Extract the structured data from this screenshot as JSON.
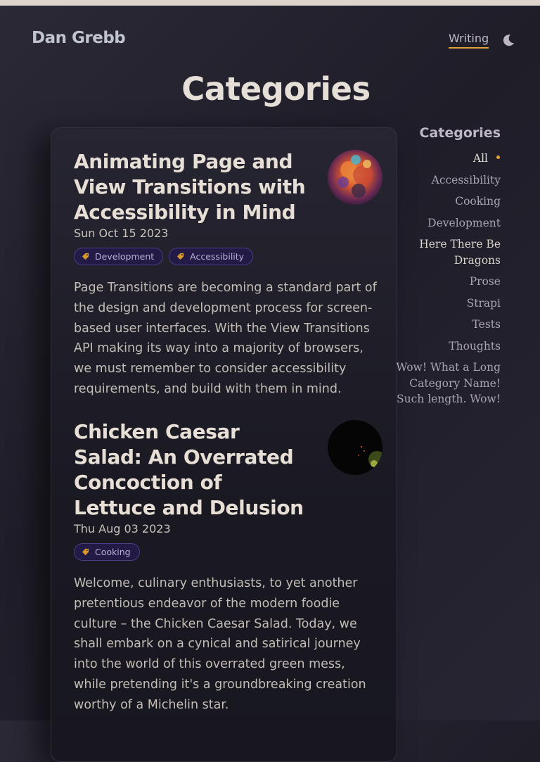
{
  "site": {
    "title": "Dan Grebb"
  },
  "nav": {
    "items": [
      {
        "label": "Writing",
        "active": true
      }
    ],
    "theme_toggle_icon": "moon-icon"
  },
  "page": {
    "heading": "Categories"
  },
  "posts": [
    {
      "title": "Animating Page and View Transitions with Accessibility in Mind",
      "date": "Sun Oct 15 2023",
      "tags": [
        "Development",
        "Accessibility"
      ],
      "excerpt": "Page Transitions are becoming a standard part of the design and development process for screen-based user interfaces. With the View Transitions API making its way into a majority of browsers, we must remember to consider accessibility requirements, and build with them in mind.",
      "thumbnail": "colorful-cloud-image"
    },
    {
      "title": "Chicken Caesar Salad: An Overrated Concoction of Lettuce and Delusion",
      "date": "Thu Aug 03 2023",
      "tags": [
        "Cooking"
      ],
      "excerpt": "Welcome, culinary enthusiasts, to yet another pretentious endeavor of the modern foodie culture – the Chicken Caesar Salad. Today, we shall embark on a cynical and satirical journey into the world of this overrated green mess, while pretending it's a groundbreaking creation worthy of a Michelin star.",
      "thumbnail": "dark-salad-image"
    }
  ],
  "sidebar": {
    "heading": "Categories",
    "categories": [
      {
        "label": "All",
        "active": true
      },
      {
        "label": "Accessibility"
      },
      {
        "label": "Cooking"
      },
      {
        "label": "Development"
      },
      {
        "label": "Here There Be Dragons"
      },
      {
        "label": "Prose"
      },
      {
        "label": "Strapi"
      },
      {
        "label": "Tests"
      },
      {
        "label": "Thoughts"
      },
      {
        "label": "Wow! What a Long Category Name! Such length. Wow!"
      }
    ]
  },
  "colors": {
    "accent": "#e0a23c",
    "tag_bg": "#231b45",
    "tag_border": "#4c3c86",
    "background": "#25232e"
  }
}
